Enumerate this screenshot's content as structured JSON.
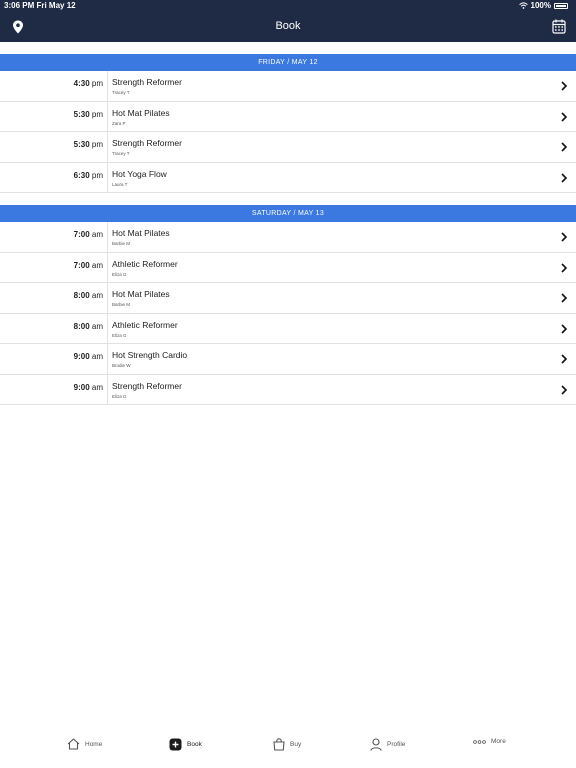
{
  "status_bar": {
    "time": "3:06 PM  Fri May 12",
    "battery": "100%"
  },
  "header": {
    "title": "Book"
  },
  "days": [
    {
      "label": "FRIDAY / MAY 12",
      "classes": [
        {
          "time": "4:30",
          "ampm": "pm",
          "name": "Strength Reformer",
          "instructor": "Tracey T"
        },
        {
          "time": "5:30",
          "ampm": "pm",
          "name": "Hot Mat Pilates",
          "instructor": "Zara P"
        },
        {
          "time": "5:30",
          "ampm": "pm",
          "name": "Strength Reformer",
          "instructor": "Tracey T"
        },
        {
          "time": "6:30",
          "ampm": "pm",
          "name": "Hot Yoga Flow",
          "instructor": "Laura T"
        }
      ]
    },
    {
      "label": "SATURDAY / MAY 13",
      "classes": [
        {
          "time": "7:00",
          "ampm": "am",
          "name": "Hot Mat Pilates",
          "instructor": "Barbie M"
        },
        {
          "time": "7:00",
          "ampm": "am",
          "name": "Athletic Reformer",
          "instructor": "Eliza G"
        },
        {
          "time": "8:00",
          "ampm": "am",
          "name": "Hot Mat Pilates",
          "instructor": "Barbie M"
        },
        {
          "time": "8:00",
          "ampm": "am",
          "name": "Athletic Reformer",
          "instructor": "Eliza G"
        },
        {
          "time": "9:00",
          "ampm": "am",
          "name": "Hot Strength Cardio",
          "instructor": "Brodie W"
        },
        {
          "time": "9:00",
          "ampm": "am",
          "name": "Strength Reformer",
          "instructor": "Eliza G"
        }
      ]
    }
  ],
  "tabs": [
    {
      "label": "Home",
      "icon": "home-icon"
    },
    {
      "label": "Book",
      "icon": "plus-square-icon"
    },
    {
      "label": "Buy",
      "icon": "bag-icon"
    },
    {
      "label": "Profile",
      "icon": "person-icon"
    },
    {
      "label": "More",
      "icon": "dots-icon"
    }
  ],
  "colors": {
    "header_bg": "#1f2a44",
    "day_header_bg": "#3b78e0"
  }
}
